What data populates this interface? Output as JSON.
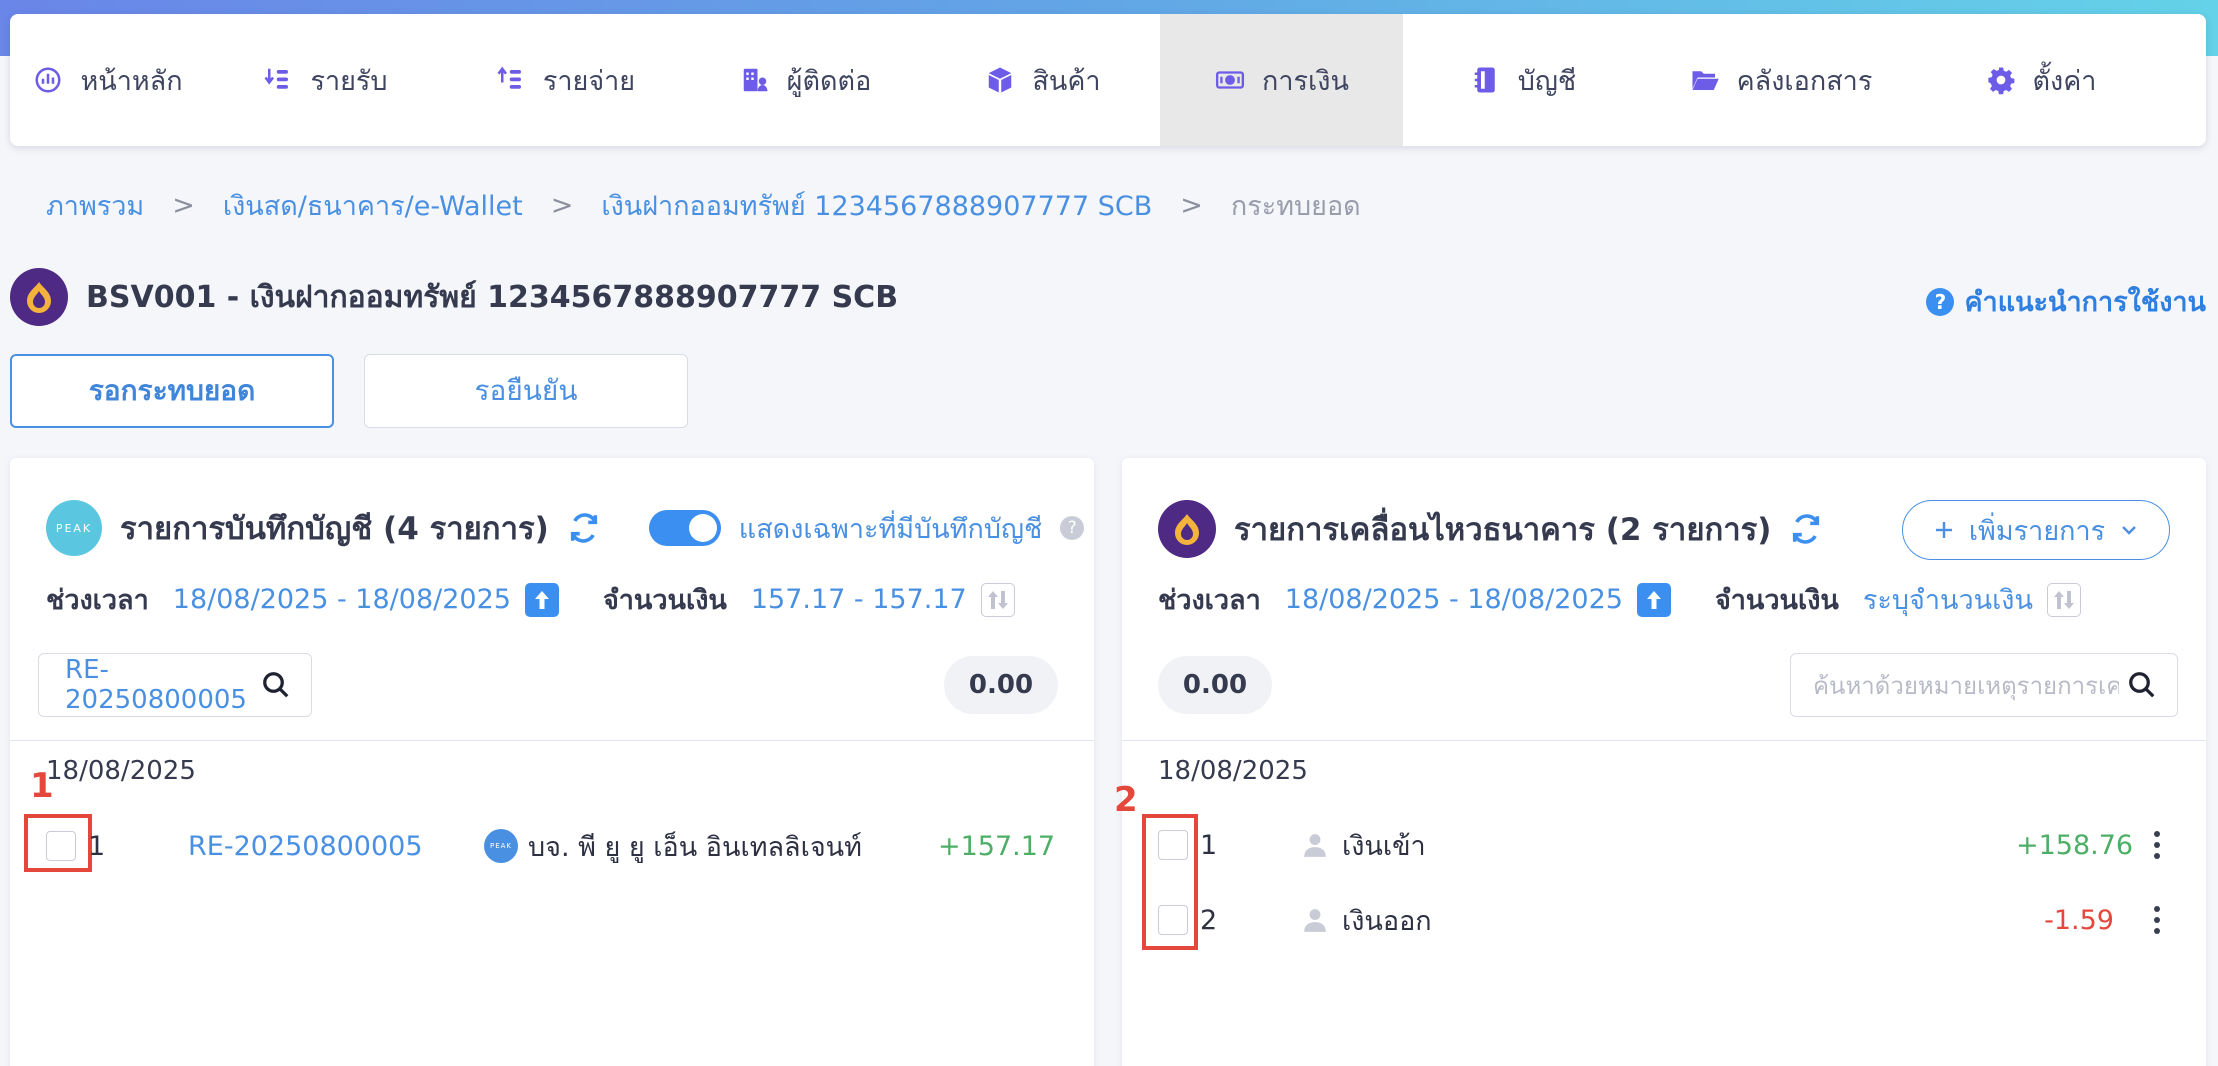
{
  "nav": {
    "items": [
      {
        "label": "หน้าหลัก",
        "icon": "dashboard-icon"
      },
      {
        "label": "รายรับ",
        "icon": "income-icon"
      },
      {
        "label": "รายจ่าย",
        "icon": "expense-icon"
      },
      {
        "label": "ผู้ติดต่อ",
        "icon": "contacts-icon"
      },
      {
        "label": "สินค้า",
        "icon": "product-box-icon"
      },
      {
        "label": "การเงิน",
        "icon": "money-icon"
      },
      {
        "label": "บัญชี",
        "icon": "ledger-book-icon"
      },
      {
        "label": "คลังเอกสาร",
        "icon": "folder-icon"
      },
      {
        "label": "ตั้งค่า",
        "icon": "gear-icon"
      }
    ],
    "active_index": 5
  },
  "breadcrumb": {
    "items": [
      "ภาพรวม",
      "เงินสด/ธนาคาร/e-Wallet",
      "เงินฝากออมทรัพย์ 1234567888907777 SCB"
    ],
    "current": "กระทบยอด",
    "separator": ">"
  },
  "account": {
    "title": "BSV001 - เงินฝากออมทรัพย์ 1234567888907777 SCB",
    "help_label": "คำแนะนำการใช้งาน",
    "help_glyph": "?"
  },
  "tabs": [
    {
      "label": "รอกระทบยอด"
    },
    {
      "label": "รอยืนยัน"
    }
  ],
  "left_panel": {
    "logo_text": "PEAK",
    "title": "รายการบันทึกบัญชี (4 รายการ)",
    "toggle_label": "แสดงเฉพาะที่มีบันทึกบัญชี",
    "tip_glyph": "?",
    "period_label": "ช่วงเวลา",
    "period_value": "18/08/2025 - 18/08/2025",
    "amount_label": "จำนวนเงิน",
    "amount_value": "157.17 - 157.17",
    "search_value": "RE-20250800005",
    "total": "0.00",
    "date": "18/08/2025",
    "annotation": "1",
    "rows": [
      {
        "no": "1",
        "doc": "RE-20250800005",
        "contact_logo": "PEAK",
        "contact": "บจ. พี ยู ยู เอ็น อินเทลลิเจนท์",
        "amount": "+157.17"
      }
    ]
  },
  "right_panel": {
    "title": "รายการเคลื่อนไหวธนาคาร (2 รายการ)",
    "add_label": "เพิ่มรายการ",
    "period_label": "ช่วงเวลา",
    "period_value": "18/08/2025 - 18/08/2025",
    "amount_label": "จำนวนเงิน",
    "amount_value": "ระบุจำนวนเงิน",
    "search_placeholder": "ค้นหาด้วยหมายเหตุรายการเคลื่อนไหว",
    "total": "0.00",
    "date": "18/08/2025",
    "annotation": "2",
    "rows": [
      {
        "no": "1",
        "desc": "เงินเข้า",
        "amount": "+158.76"
      },
      {
        "no": "2",
        "desc": "เงินออก",
        "amount": "-1.59"
      }
    ]
  },
  "colors": {
    "accent": "#4a90e2",
    "positive": "#4caf65",
    "negative": "#e4473b",
    "bank_purple": "#4e2a84",
    "peak_blue": "#5bc6e0"
  }
}
